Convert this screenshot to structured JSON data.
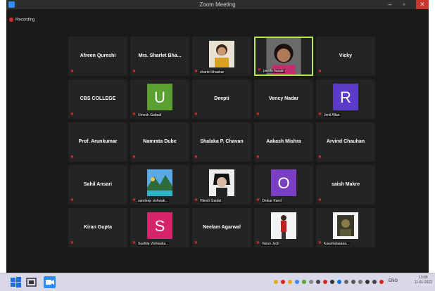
{
  "window": {
    "title": "Zoom Meeting",
    "minimize": "–",
    "maximize": "▫",
    "close": "✕"
  },
  "recording": {
    "label": "Recording"
  },
  "participants": [
    {
      "name": "Afreen Qureshi",
      "label": ""
    },
    {
      "name": "Mrs. Sharlet Bha...",
      "label": ""
    },
    {
      "name": "",
      "label": "sharlet bhaskar",
      "photo": "portrait-girl"
    },
    {
      "name": "",
      "label": "parithi husain",
      "photo": "webcam-woman",
      "active": true
    },
    {
      "name": "Vicky",
      "label": ""
    },
    {
      "name": "CBS COLLEGE",
      "label": ""
    },
    {
      "name": "",
      "label": "Umesh Gabadi",
      "avatar_letter": "U",
      "avatar_color": "#5aa132"
    },
    {
      "name": "Deepti",
      "label": ""
    },
    {
      "name": "Vency Nadar",
      "label": ""
    },
    {
      "name": "",
      "label": "Jenil Allan",
      "avatar_letter": "R",
      "avatar_color": "#5c3bc7"
    },
    {
      "name": "Prof. Arunkumar",
      "label": ""
    },
    {
      "name": "Namrata Dube",
      "label": ""
    },
    {
      "name": "Shalaka P. Chavan",
      "label": ""
    },
    {
      "name": "Aakash Mishra",
      "label": ""
    },
    {
      "name": "Arvind Chauhan",
      "label": ""
    },
    {
      "name": "Sahil Ansari",
      "label": ""
    },
    {
      "name": "",
      "label": "sandeep vishwak...",
      "photo": "landscape"
    },
    {
      "name": "",
      "label": "Hitesh Gadati",
      "photo": "anime"
    },
    {
      "name": "",
      "label": "Omkar Kand",
      "avatar_letter": "O",
      "avatar_color": "#7b3fc4"
    },
    {
      "name": "saish Makre",
      "label": ""
    },
    {
      "name": "Kiran Gupta",
      "label": ""
    },
    {
      "name": "",
      "label": "Sushila Vishwaka...",
      "avatar_letter": "S",
      "avatar_color": "#d6236a"
    },
    {
      "name": "Neelam Agarwal",
      "label": ""
    },
    {
      "name": "",
      "label": "Varun Jyoti",
      "photo": "girl-red"
    },
    {
      "name": "",
      "label": "Kaushalaaaaa...",
      "photo": "dark-scene"
    }
  ],
  "taskbar": {
    "clock_time": "13:05",
    "clock_date": "11-01-2022",
    "lang": "ENG"
  },
  "colors": {
    "active_border": "#b7e84a",
    "mute": "#e02828"
  }
}
